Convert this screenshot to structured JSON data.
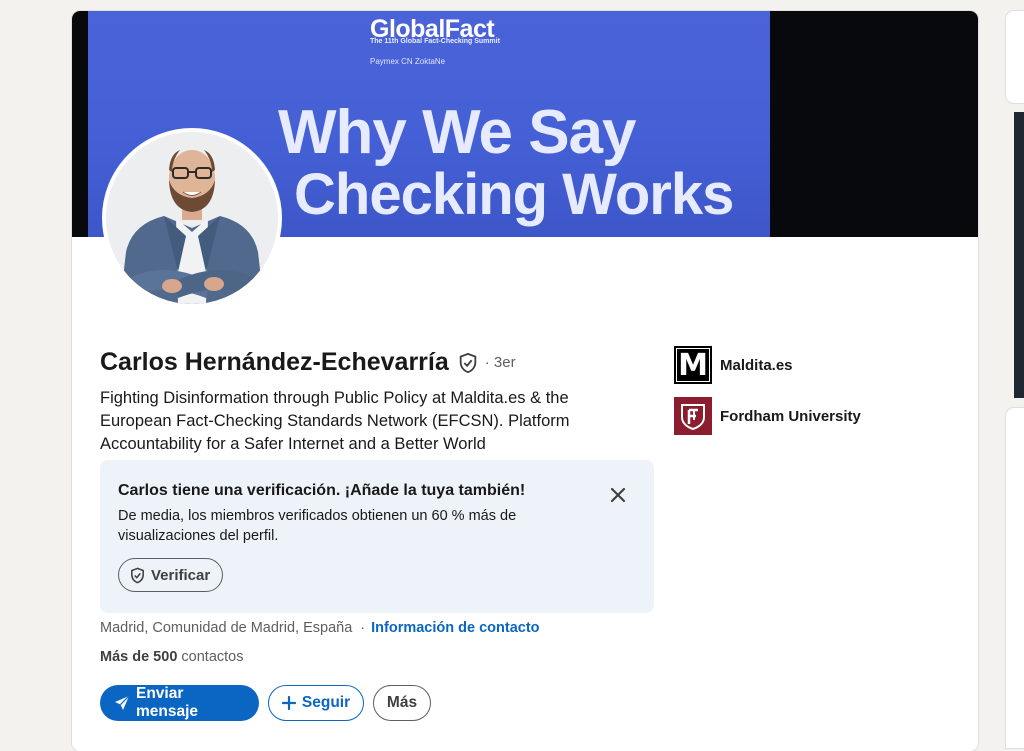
{
  "banner": {
    "event_logo": "GlobalFact",
    "event_subtitle": "The 11th Global Fact-Checking Summit",
    "sponsors": "Paymex  CN  ZoktaNe",
    "slogan_line1": "Why We Say",
    "slogan_line2": "Checking Works"
  },
  "profile": {
    "name": "Carlos Hernández-Echevarría",
    "degree": "· 3er",
    "headline": "Fighting Disinformation through Public Policy at Maldita.es & the European Fact-Checking Standards Network (EFCSN). Platform Accountability for a Safer Internet and a Better World",
    "location": "Madrid, Comunidad de Madrid, España",
    "location_separator": "·",
    "contact_info_label": "Información de contacto",
    "connections_count": "Más de 500",
    "connections_label": "contactos"
  },
  "verification": {
    "title": "Carlos tiene una verificación. ¡Añade la tuya también!",
    "text": "De media, los miembros verificados obtienen un 60 % más de visualizaciones del perfil.",
    "button_label": "Verificar"
  },
  "actions": {
    "message_label": "Enviar mensaje",
    "follow_label": "Seguir",
    "more_label": "Más"
  },
  "organizations": [
    {
      "name": "Maldita.es",
      "logo_letter": "M",
      "icon": "maldita-logo"
    },
    {
      "name": "Fordham University",
      "icon": "fordham-logo"
    }
  ],
  "colors": {
    "primary": "#0a66c2",
    "page_background": "#f4f2ee",
    "verification_box": "#edf3f8",
    "fordham": "#8c1d2e"
  }
}
